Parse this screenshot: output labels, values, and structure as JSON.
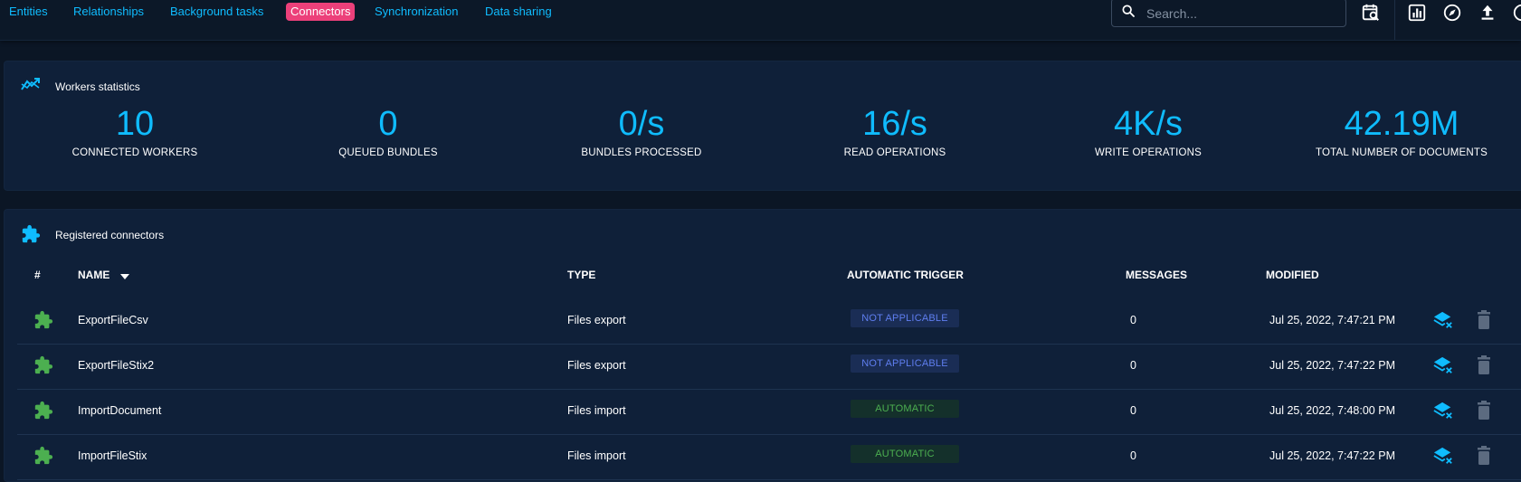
{
  "nav": {
    "tabs": [
      {
        "label": "Entities",
        "active": false
      },
      {
        "label": "Relationships",
        "active": false
      },
      {
        "label": "Background tasks",
        "active": false
      },
      {
        "label": "Connectors",
        "active": true
      },
      {
        "label": "Synchronization",
        "active": false
      },
      {
        "label": "Data sharing",
        "active": false
      }
    ]
  },
  "search": {
    "placeholder": "Search...",
    "value": ""
  },
  "toolbar_icons": [
    "search-calendar-icon",
    "chart-icon",
    "compass-icon",
    "upload-icon",
    "account-icon"
  ],
  "workers": {
    "title": "Workers statistics",
    "stats": [
      {
        "value": "10",
        "label": "CONNECTED WORKERS"
      },
      {
        "value": "0",
        "label": "QUEUED BUNDLES"
      },
      {
        "value": "0/s",
        "label": "BUNDLES PROCESSED"
      },
      {
        "value": "16/s",
        "label": "READ OPERATIONS"
      },
      {
        "value": "4K/s",
        "label": "WRITE OPERATIONS"
      },
      {
        "value": "42.19M",
        "label": "TOTAL NUMBER OF DOCUMENTS"
      }
    ]
  },
  "connectors": {
    "title": "Registered connectors",
    "columns": {
      "index": "#",
      "name": "NAME",
      "type": "TYPE",
      "trigger": "AUTOMATIC TRIGGER",
      "messages": "MESSAGES",
      "modified": "MODIFIED"
    },
    "sort": {
      "column": "name",
      "direction": "desc"
    },
    "rows": [
      {
        "name": "ExportFileCsv",
        "type": "Files export",
        "trigger": "NOT APPLICABLE",
        "trigger_kind": "na",
        "messages": "0",
        "modified": "Jul 25, 2022, 7:47:21 PM"
      },
      {
        "name": "ExportFileStix2",
        "type": "Files export",
        "trigger": "NOT APPLICABLE",
        "trigger_kind": "na",
        "messages": "0",
        "modified": "Jul 25, 2022, 7:47:22 PM"
      },
      {
        "name": "ImportDocument",
        "type": "Files import",
        "trigger": "AUTOMATIC",
        "trigger_kind": "auto",
        "messages": "0",
        "modified": "Jul 25, 2022, 7:48:00 PM"
      },
      {
        "name": "ImportFileStix",
        "type": "Files import",
        "trigger": "AUTOMATIC",
        "trigger_kind": "auto",
        "messages": "0",
        "modified": "Jul 25, 2022, 7:47:22 PM"
      }
    ]
  },
  "colors": {
    "accent": "#0fbcff",
    "active_tab": "#ec407a",
    "connector_active": "#4caf50",
    "na_chip_text": "#5f7ef0",
    "auto_chip_text": "#4caf50"
  }
}
